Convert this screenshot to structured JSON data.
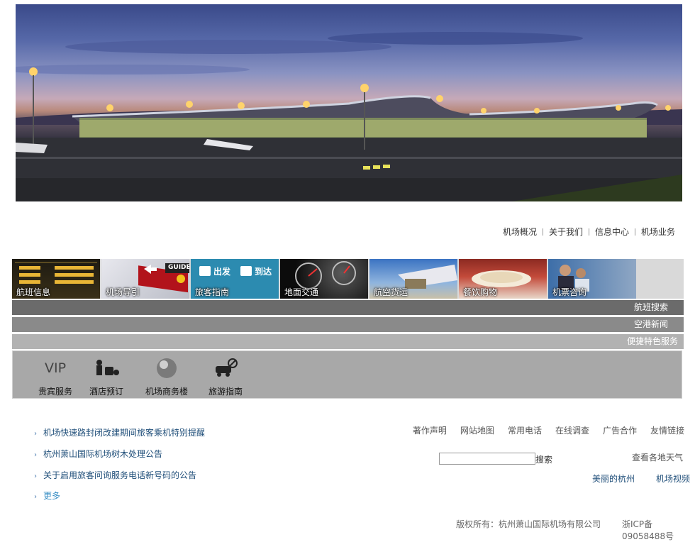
{
  "top_nav": [
    "机场概况",
    "关于我们",
    "信息中心",
    "机场业务"
  ],
  "tiles": [
    {
      "label": "航班信息",
      "icon": "departure-board"
    },
    {
      "label": "机场导引",
      "icon": "guide-sign",
      "sign_text": "GUIDE"
    },
    {
      "label": "旅客指南",
      "icon": "departure-arrival-sign",
      "sign_left": "出发",
      "sign_right": "到达"
    },
    {
      "label": "地面交通",
      "icon": "car-dashboard"
    },
    {
      "label": "航空货运",
      "icon": "cargo-plane"
    },
    {
      "label": "餐饮购物",
      "icon": "dinner-plates"
    },
    {
      "label": "机票咨询",
      "icon": "ticket-staff"
    }
  ],
  "bars": [
    "航班搜索",
    "空港新闻",
    "便捷特色服务"
  ],
  "services": [
    {
      "label": "贵宾服务",
      "icon_text": "VIP"
    },
    {
      "label": "酒店预订",
      "icon": "porter-icon"
    },
    {
      "label": "机场商务楼",
      "icon": "globe-icon"
    },
    {
      "label": "旅游指南",
      "icon": "travel-car-icon"
    }
  ],
  "news": [
    "机场快速路封闭改建期间旅客乘机特别提醒",
    "杭州萧山国际机场树木处理公告",
    "关于启用旅客问询服务电话新号码的公告"
  ],
  "news_more": "更多",
  "footer_links": [
    "著作声明",
    "网站地图",
    "常用电话",
    "在线调查",
    "广告合作",
    "友情链接"
  ],
  "search": {
    "value": "",
    "button": "搜索"
  },
  "weather_link": "查看各地天气",
  "hangzhou_link": "美丽的杭州",
  "video_link": "机场视频",
  "copyright": "版权所有：杭州萧山国际机场有限公司",
  "icp": "浙ICP备09058488号",
  "colors": {
    "bar1": "#6b6b6b",
    "bar2": "#8a8a8a",
    "bar3": "#b2b2b2",
    "link": "#1f4e79"
  }
}
